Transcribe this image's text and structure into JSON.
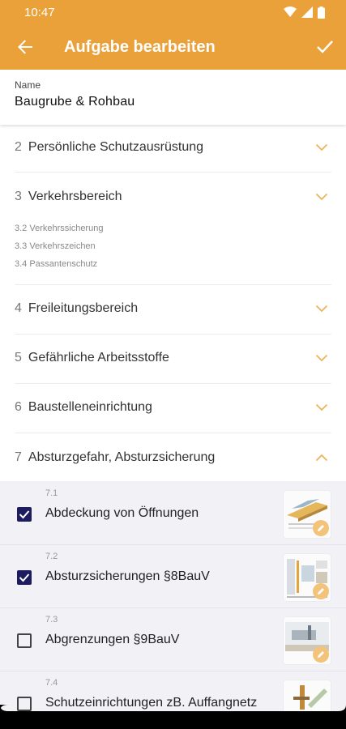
{
  "status_bar": {
    "time": "10:47"
  },
  "app_bar": {
    "title": "Aufgabe bearbeiten"
  },
  "name_field": {
    "label": "Name",
    "value": "Baugrube & Rohbau"
  },
  "sections": [
    {
      "number": "2",
      "label": "Persönliche Schutzausrüstung",
      "expanded": false
    },
    {
      "number": "3",
      "label": "Verkehrsbereich",
      "expanded": false,
      "subitems": [
        "3.2 Verkehrssicherung",
        "3.3 Verkehrszeichen",
        "3.4 Passantenschutz"
      ]
    },
    {
      "number": "4",
      "label": "Freileitungsbereich",
      "expanded": false
    },
    {
      "number": "5",
      "label": "Gefährliche Arbeitsstoffe",
      "expanded": false
    },
    {
      "number": "6",
      "label": "Baustelleneinrichtung",
      "expanded": false
    },
    {
      "number": "7",
      "label": "Absturzgefahr, Absturzsicherung",
      "expanded": true
    }
  ],
  "tasks": [
    {
      "number": "7.1",
      "label": "Abdeckung von Öffnungen",
      "checked": true
    },
    {
      "number": "7.2",
      "label": "Absturzsicherungen §8BauV",
      "checked": true
    },
    {
      "number": "7.3",
      "label": "Abgrenzungen §9BauV",
      "checked": false
    },
    {
      "number": "7.4",
      "label": "Schutzeinrichtungen zB. Auffangnetz",
      "checked": false
    }
  ],
  "colors": {
    "accent": "#eba13a",
    "checkbox": "#1d1c5e",
    "chevron": "#efb35a",
    "sub_background": "#f1f1f6"
  }
}
